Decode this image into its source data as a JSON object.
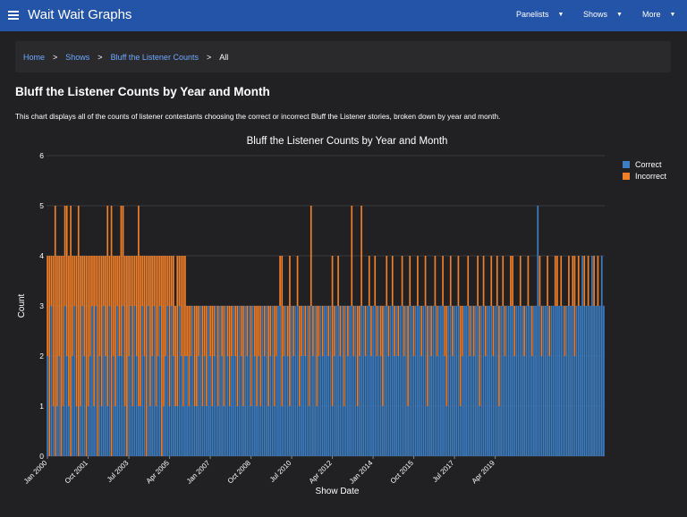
{
  "header": {
    "title": "Wait Wait Graphs",
    "nav": [
      {
        "label": "Panelists"
      },
      {
        "label": "Shows"
      },
      {
        "label": "More"
      }
    ]
  },
  "breadcrumb": {
    "items": [
      "Home",
      "Shows",
      "Bluff the Listener Counts"
    ],
    "current": "All"
  },
  "page": {
    "title": "Bluff the Listener Counts by Year and Month",
    "description": "This chart displays all of the counts of listener contestants choosing the correct or incorrect Bluff the Listener stories, broken down by year and month."
  },
  "colors": {
    "correct": "#3d7ec3",
    "incorrect": "#f07f2a",
    "accent": "#2354a7"
  },
  "chart_data": {
    "type": "bar",
    "stacked": true,
    "title": "Bluff the Listener Counts by Year and Month",
    "xlabel": "Show Date",
    "ylabel": "Count",
    "ylim": [
      0,
      6
    ],
    "yticks": [
      0,
      1,
      2,
      3,
      4,
      5,
      6
    ],
    "grid": true,
    "legend": "top-right",
    "x_start": "2000-01",
    "x_ticks": [
      "Jan 2000",
      "Oct 2001",
      "Jul 2003",
      "Apr 2005",
      "Jan 2007",
      "Oct 2008",
      "Jul 2010",
      "Apr 2012",
      "Jan 2014",
      "Oct 2015",
      "Jul 2017",
      "Apr 2019"
    ],
    "series": [
      {
        "name": "Correct",
        "values": [
          2,
          0,
          3,
          1,
          0,
          1,
          2,
          0,
          1,
          3,
          2,
          1,
          0,
          2,
          3,
          1,
          0,
          1,
          3,
          2,
          0,
          1,
          2,
          3,
          1,
          3,
          0,
          2,
          1,
          3,
          2,
          1,
          3,
          0,
          2,
          1,
          3,
          2,
          2,
          3,
          1,
          0,
          2,
          3,
          1,
          3,
          2,
          1,
          1,
          3,
          2,
          0,
          3,
          1,
          2,
          3,
          1,
          2,
          3,
          0,
          1,
          2,
          3,
          1,
          3,
          2,
          1,
          1,
          3,
          2,
          1,
          2,
          2,
          1,
          2,
          3,
          1,
          1,
          2,
          3,
          1,
          2,
          1,
          3,
          2,
          1,
          2,
          3,
          1,
          3,
          2,
          1,
          3,
          2,
          1,
          2,
          3,
          2,
          1,
          3,
          2,
          1,
          3,
          2,
          3,
          1,
          3,
          2,
          1,
          2,
          1,
          3,
          2,
          3,
          1,
          2,
          3,
          1,
          2,
          3,
          3,
          1,
          2,
          3,
          2,
          1,
          3,
          2,
          3,
          3,
          1,
          2,
          3,
          2,
          3,
          1,
          3,
          2,
          3,
          1,
          2,
          3,
          2,
          3,
          3,
          2,
          3,
          1,
          2,
          3,
          3,
          2,
          3,
          1,
          3,
          2,
          3,
          3,
          2,
          3,
          1,
          2,
          3,
          3,
          2,
          3,
          3,
          2,
          3,
          3,
          2,
          3,
          2,
          1,
          3,
          3,
          2,
          3,
          3,
          2,
          3,
          2,
          3,
          3,
          2,
          3,
          1,
          3,
          3,
          2,
          3,
          3,
          3,
          2,
          3,
          3,
          1,
          3,
          2,
          3,
          3,
          2,
          3,
          3,
          3,
          2,
          1,
          3,
          3,
          2,
          3,
          3,
          3,
          1,
          2,
          3,
          3,
          3,
          2,
          3,
          2,
          3,
          3,
          1,
          3,
          3,
          2,
          3,
          3,
          3,
          2,
          3,
          3,
          1,
          3,
          3,
          2,
          3,
          3,
          3,
          3,
          2,
          3,
          3,
          3,
          3,
          2,
          3,
          3,
          3,
          2,
          3,
          3,
          5,
          3,
          2,
          3,
          3,
          3,
          2,
          3,
          3,
          3,
          3,
          3,
          3,
          3,
          2,
          3,
          3,
          3,
          3,
          2,
          3,
          3,
          3,
          4,
          3,
          3,
          3,
          3,
          4,
          3,
          3,
          3,
          3,
          4,
          3
        ]
      },
      {
        "name": "Incorrect",
        "values": [
          2,
          4,
          1,
          3,
          5,
          3,
          2,
          4,
          3,
          2,
          3,
          3,
          5,
          2,
          1,
          3,
          5,
          3,
          1,
          2,
          4,
          3,
          2,
          1,
          3,
          1,
          4,
          2,
          3,
          1,
          2,
          4,
          1,
          5,
          2,
          3,
          1,
          2,
          3,
          2,
          3,
          4,
          2,
          1,
          3,
          1,
          2,
          4,
          3,
          1,
          2,
          4,
          1,
          3,
          2,
          1,
          3,
          2,
          1,
          4,
          3,
          2,
          1,
          3,
          1,
          2,
          2,
          3,
          1,
          2,
          3,
          2,
          1,
          2,
          1,
          0,
          2,
          2,
          1,
          0,
          2,
          1,
          2,
          0,
          1,
          2,
          1,
          0,
          2,
          0,
          1,
          2,
          0,
          1,
          2,
          1,
          0,
          1,
          2,
          0,
          1,
          2,
          0,
          1,
          0,
          2,
          0,
          1,
          2,
          1,
          2,
          0,
          1,
          0,
          2,
          1,
          0,
          2,
          1,
          0,
          1,
          3,
          1,
          0,
          1,
          3,
          0,
          1,
          0,
          1,
          2,
          1,
          0,
          1,
          0,
          2,
          2,
          1,
          0,
          2,
          1,
          0,
          1,
          0,
          0,
          1,
          0,
          3,
          1,
          0,
          1,
          1,
          0,
          2,
          0,
          1,
          0,
          2,
          1,
          0,
          2,
          1,
          2,
          0,
          1,
          0,
          1,
          1,
          0,
          1,
          1,
          0,
          1,
          2,
          0,
          1,
          1,
          0,
          1,
          1,
          0,
          1,
          0,
          1,
          1,
          0,
          2,
          1,
          0,
          1,
          0,
          1,
          0,
          1,
          0,
          1,
          2,
          0,
          1,
          0,
          1,
          1,
          0,
          0,
          1,
          1,
          2,
          0,
          1,
          1,
          0,
          0,
          1,
          2,
          1,
          0,
          0,
          1,
          1,
          0,
          1,
          0,
          1,
          2,
          0,
          1,
          1,
          0,
          0,
          1,
          1,
          0,
          1,
          2,
          0,
          1,
          1,
          0,
          0,
          1,
          1,
          1,
          0,
          0,
          1,
          0,
          1,
          0,
          1,
          0,
          1,
          0,
          0,
          0,
          1,
          1,
          0,
          0,
          1,
          1,
          0,
          0,
          1,
          1,
          0,
          1,
          0,
          1,
          0,
          1,
          0,
          1,
          2,
          0,
          1,
          0,
          0,
          1,
          0,
          1,
          0,
          0,
          1,
          0,
          1,
          0,
          0,
          0
        ]
      }
    ]
  }
}
